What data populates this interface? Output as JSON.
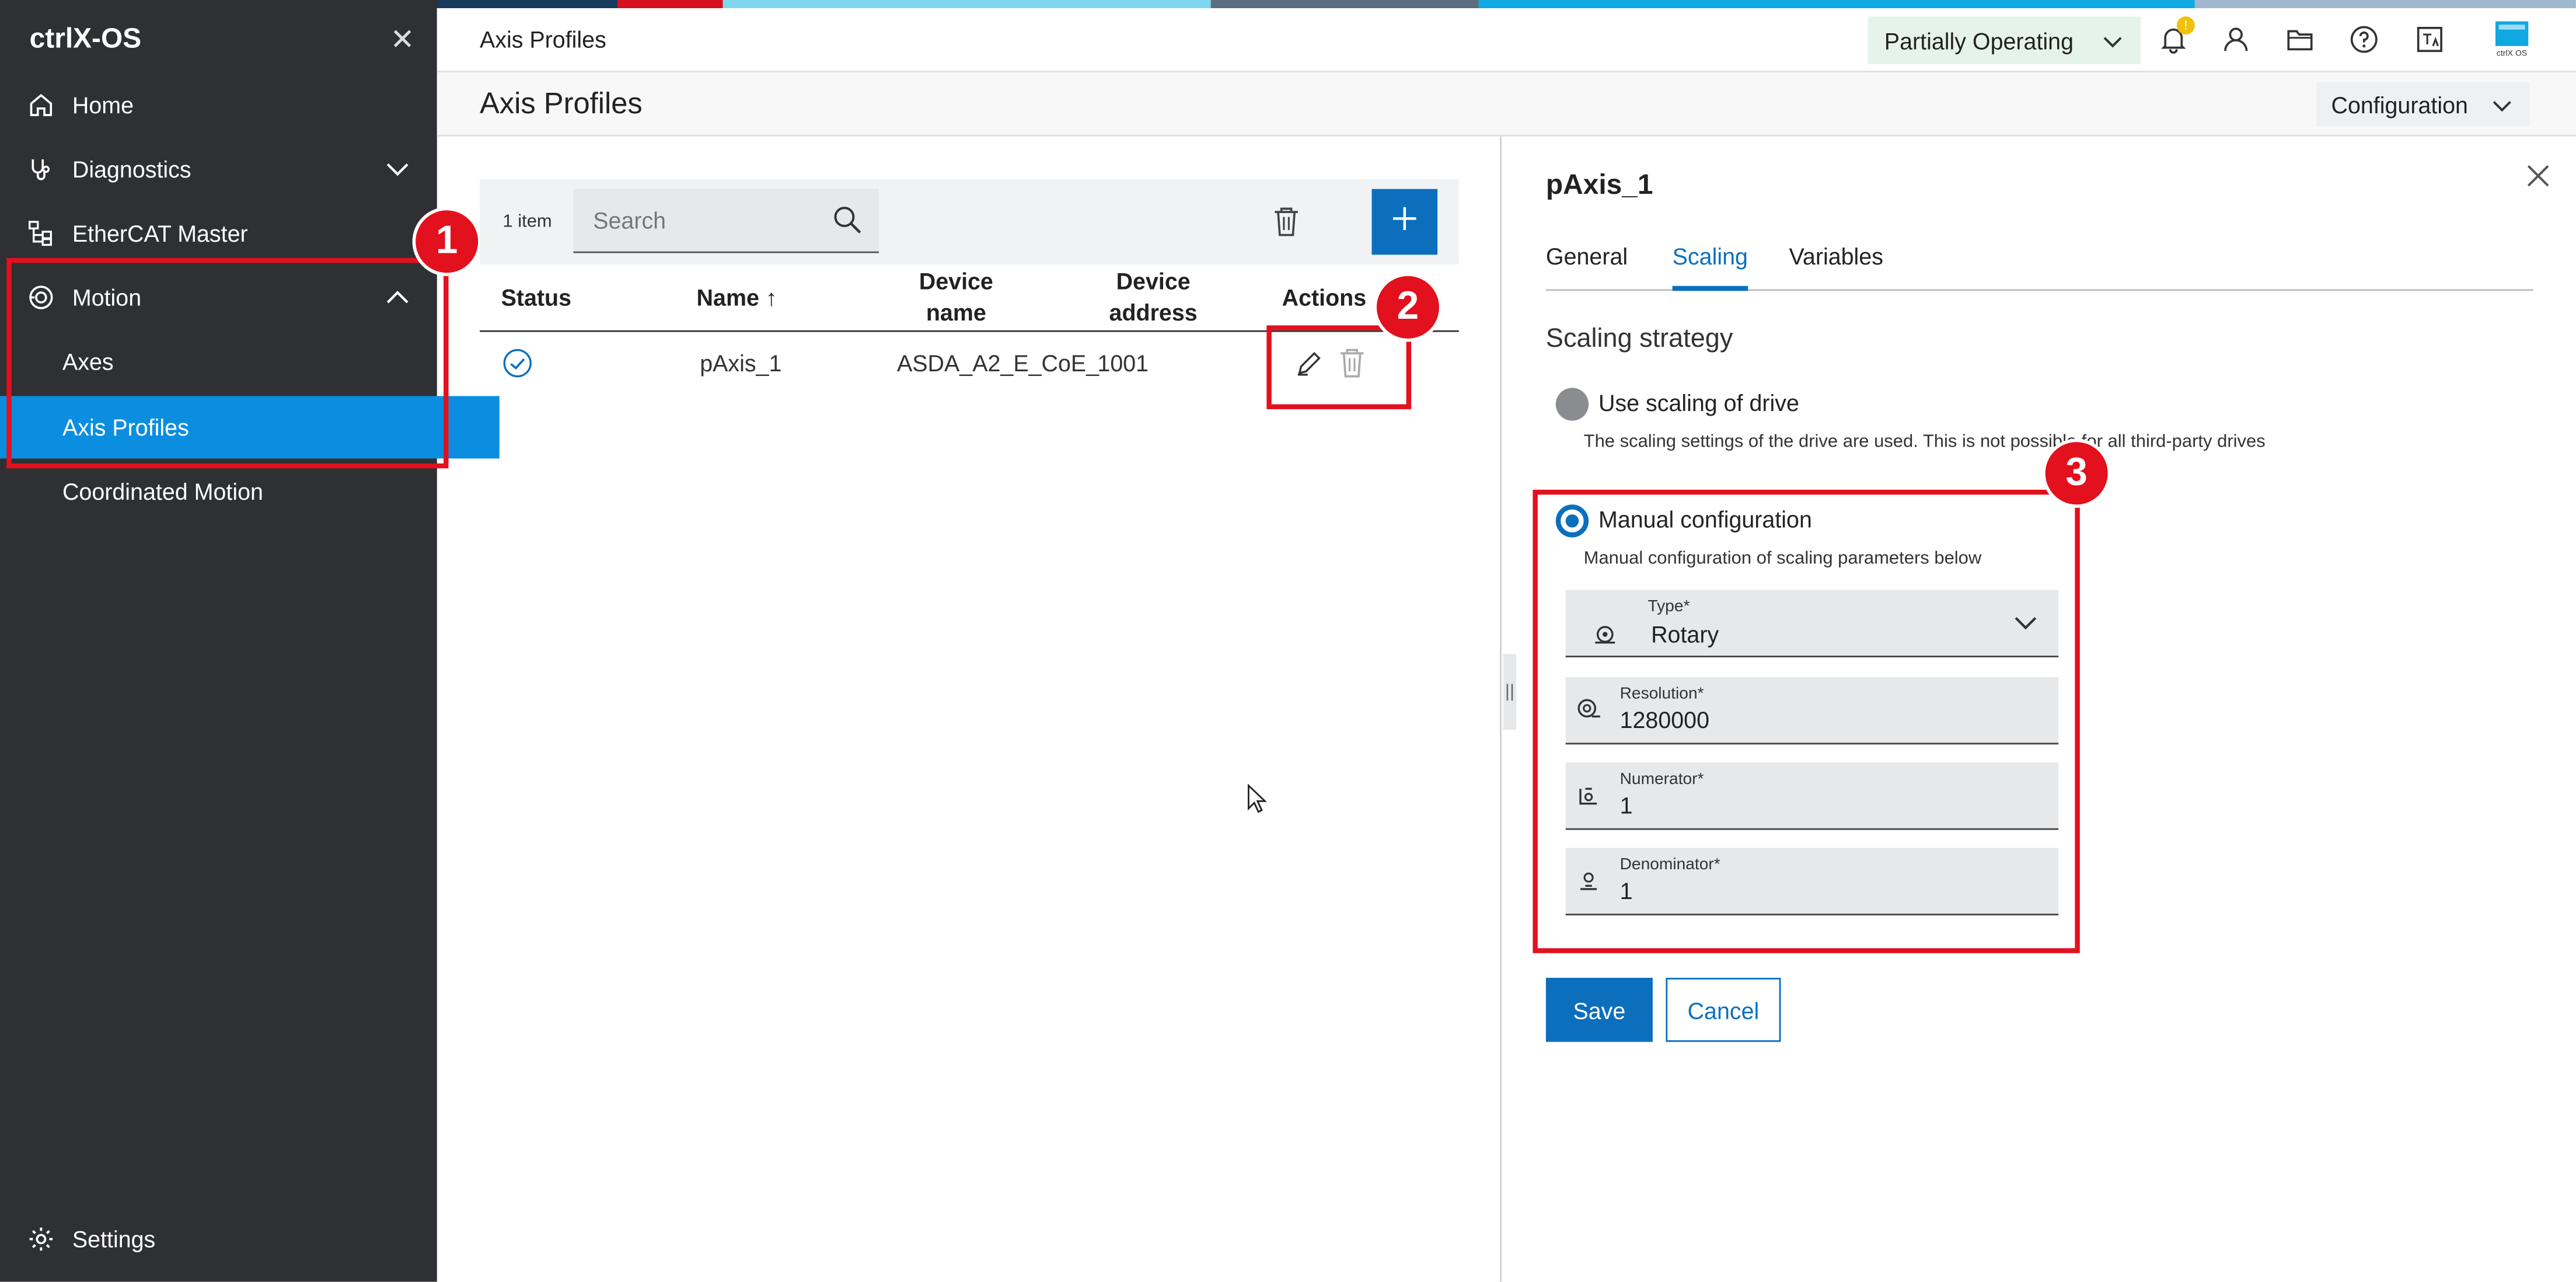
{
  "colors": {
    "accent": "#0b6fbd",
    "sidebar_bg": "#2f3033",
    "active_item": "#0b8ee0",
    "annotation": "#e3101d",
    "status_bg": "#e5f3ea"
  },
  "sidebar": {
    "title": "ctrlX-OS",
    "items": [
      {
        "label": "Home",
        "icon": "home-icon"
      },
      {
        "label": "Diagnostics",
        "icon": "stethoscope-icon"
      },
      {
        "label": "EtherCAT Master",
        "icon": "network-icon"
      },
      {
        "label": "Motion",
        "icon": "motion-icon"
      },
      {
        "label": "Axes"
      },
      {
        "label": "Axis Profiles"
      },
      {
        "label": "Coordinated Motion"
      }
    ],
    "settings_label": "Settings"
  },
  "header": {
    "breadcrumb": "Axis Profiles",
    "status": "Partially Operating",
    "notification_count": "!",
    "logo_text": "ctrlX OS"
  },
  "page": {
    "title": "Axis Profiles",
    "configuration_label": "Configuration"
  },
  "list": {
    "count": "1 item",
    "search_placeholder": "Search",
    "columns": {
      "status": "Status",
      "name": "Name ↑",
      "device_name": "Device name",
      "device_address": "Device address",
      "actions": "Actions"
    },
    "rows": [
      {
        "name": "pAxis_1",
        "device_name": "ASDA_A2_E_CoE_",
        "device_address": "1001"
      }
    ]
  },
  "annotations": {
    "one": "1",
    "two": "2",
    "three": "3"
  },
  "detail": {
    "title": "pAxis_1",
    "tabs": [
      "General",
      "Scaling",
      "Variables"
    ],
    "section_title": "Scaling strategy",
    "option_drive": {
      "label": "Use scaling of drive",
      "desc": "The scaling settings of the drive are used. This is not possible for all third-party drives"
    },
    "option_manual": {
      "label": "Manual configuration",
      "desc": "Manual configuration of scaling parameters below"
    },
    "fields": {
      "type": {
        "label": "Type*",
        "value": "Rotary"
      },
      "resolution": {
        "label": "Resolution*",
        "value": "1280000"
      },
      "numerator": {
        "label": "Numerator*",
        "value": "1"
      },
      "denominator": {
        "label": "Denominator*",
        "value": "1"
      }
    },
    "save_label": "Save",
    "cancel_label": "Cancel"
  }
}
